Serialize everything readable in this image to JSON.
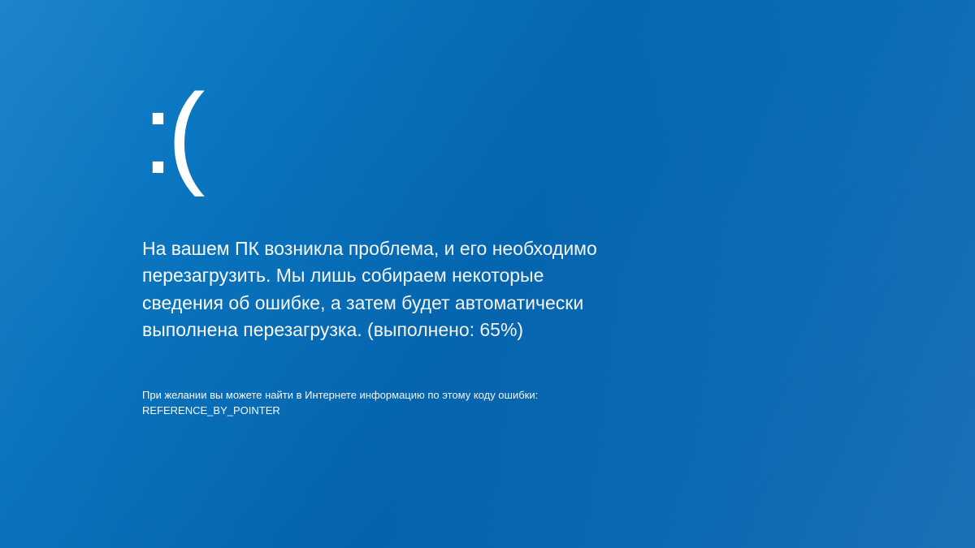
{
  "bsod": {
    "emoticon": ":(",
    "message": "На вашем ПК возникла проблема, и его необходимо перезагрузить. Мы лишь собираем некоторые сведения об ошибке, а затем будет автоматически выполнена перезагрузка. (выполнено: 65%)",
    "progress_percent": 65,
    "error_info": "При желании вы можете найти в Интернете информацию по этому коду ошибки: REFERENCE_BY_POINTER",
    "error_code": "REFERENCE_BY_POINTER"
  },
  "colors": {
    "background": "#0571bd",
    "text": "#ffffff"
  }
}
